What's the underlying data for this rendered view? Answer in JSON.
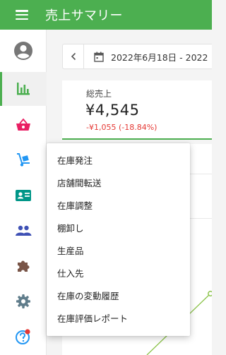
{
  "header": {
    "title": "売上サマリー"
  },
  "sidebar": {
    "items": [
      {
        "icon": "avatar-icon"
      },
      {
        "icon": "bar-chart-icon",
        "active": true
      },
      {
        "icon": "basket-icon"
      },
      {
        "icon": "hand-truck-icon"
      },
      {
        "icon": "id-card-icon"
      },
      {
        "icon": "people-icon"
      },
      {
        "icon": "puzzle-icon"
      },
      {
        "icon": "gear-icon"
      },
      {
        "icon": "help-icon"
      }
    ]
  },
  "date_range": {
    "text": "2022年6月18日 - 2022"
  },
  "summary_card": {
    "label": "総売上",
    "value": "¥4,545",
    "change": "-¥1,055 (-18.84%)"
  },
  "dropdown_menu": {
    "items": [
      "在庫発注",
      "店舗間転送",
      "在庫調整",
      "棚卸し",
      "生産品",
      "仕入先",
      "在庫の変動履歴",
      "在庫評価レポート"
    ]
  },
  "colors": {
    "primary": "#4caf50",
    "negative": "#e53935",
    "basket": "#e91e63",
    "truck": "#2196f3",
    "id_card": "#009688",
    "people": "#3f51b5",
    "puzzle": "#795548",
    "gear": "#607d8b",
    "help": "#2196f3"
  }
}
